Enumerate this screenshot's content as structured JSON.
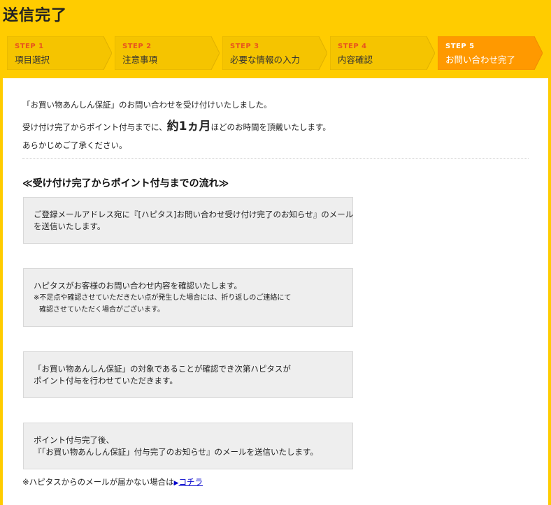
{
  "page_title": "送信完了",
  "steps": [
    {
      "no": "STEP 1",
      "label": "項目選択",
      "active": false
    },
    {
      "no": "STEP 2",
      "label": "注意事項",
      "active": false
    },
    {
      "no": "STEP 3",
      "label": "必要な情報の入力",
      "active": false
    },
    {
      "no": "STEP 4",
      "label": "内容確認",
      "active": false
    },
    {
      "no": "STEP 5",
      "label": "お問い合わせ完了",
      "active": true
    }
  ],
  "intro": {
    "line1": "「お買い物あんしん保証」のお問い合わせを受け付けいたしました。",
    "line2_pre": "受け付け完了からポイント付与までに、",
    "line2_em": "約1ヵ月",
    "line2_post": "ほどのお時間を頂戴いたします。",
    "line3": "あらかじめご了承ください。"
  },
  "flow": {
    "title": "≪受け付け完了からポイント付与までの流れ≫",
    "box1": {
      "line1": "ご登録メールアドレス宛に『[ハピタス]お問い合わせ受け付け完了のお知らせ』のメール",
      "line2": "を送信いたします。"
    },
    "box2": {
      "line1": "ハピタスがお客様のお問い合わせ内容を確認いたします。",
      "note1": "※不足点や確認させていただきたい点が発生した場合には、折り返しのご連絡にて",
      "note2": "確認させていただく場合がございます。"
    },
    "box3": {
      "line1": "「お買い物あんしん保証」の対象であることが確認でき次第ハピタスが",
      "line2": "ポイント付与を行わせていただきます。"
    },
    "box4": {
      "line1": "ポイント付与完了後、",
      "line2": "『「お買い物あんしん保証」付与完了のお知らせ』のメールを送信いたします。"
    }
  },
  "footer_note": {
    "text": "※ハピタスからのメールが届かない場合は",
    "arrow": "▶",
    "link": "コチラ"
  },
  "colors": {
    "background": "#ffcc00",
    "step_inactive": "#f5c400",
    "step_active": "#ff9900",
    "step_number": "#e8541e",
    "link": "#0000cc"
  }
}
